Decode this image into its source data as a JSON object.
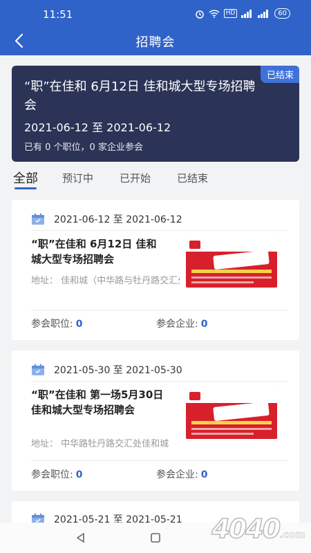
{
  "status": {
    "time": "11:51",
    "battery": "60",
    "hd": "HD"
  },
  "nav": {
    "title": "招聘会"
  },
  "hero": {
    "badge": "已结束",
    "title": "“职”在佳和 6月12日 佳和城大型专场招聘会",
    "date_range": "2021-06-12 至 2021-06-12",
    "stats": "已有 0 个职位，0 家企业参会"
  },
  "tabs": [
    "全部",
    "预订中",
    "已开始",
    "已结束"
  ],
  "cards": [
    {
      "date_range": "2021-06-12 至 2021-06-12",
      "title": "“职”在佳和 6月12日 佳和城大型专场招聘会",
      "address": "地址： 佳和城（中华路与牡丹路交汇处）",
      "positions_label": "参会职位:",
      "positions": "0",
      "companies_label": "参会企业:",
      "companies": "0"
    },
    {
      "date_range": "2021-05-30 至 2021-05-30",
      "title": "“职”在佳和 第一场5月30日 佳和城大型专场招聘会",
      "address": "地址： 中华路牡丹路交汇处佳和城",
      "positions_label": "参会职位:",
      "positions": "0",
      "companies_label": "参会企业:",
      "companies": "0"
    },
    {
      "date_range": "2021-05-21 至 2021-05-21"
    }
  ],
  "watermark": {
    "main": "4040",
    "suffix": ".com"
  },
  "colors": {
    "primary": "#2f63c9",
    "hero_bg": "#2b3356",
    "badge": "#3f72d8"
  }
}
